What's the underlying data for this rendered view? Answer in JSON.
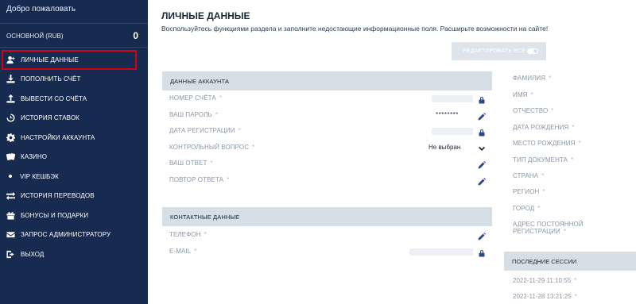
{
  "sidebar": {
    "welcome": "Добро пожаловать",
    "balance_label": "ОСНОВНОЙ (RUB)",
    "balance_value": "0",
    "items": [
      {
        "label": "ЛИЧНЫЕ ДАННЫЕ",
        "icon": "user-add-icon",
        "active": true
      },
      {
        "label": "ПОПОЛНИТЬ СЧЁТ",
        "icon": "download-icon"
      },
      {
        "label": "ВЫВЕСТИ СО СЧЁТА",
        "icon": "upload-icon"
      },
      {
        "label": "ИСТОРИЯ СТАВОК",
        "icon": "history-icon"
      },
      {
        "label": "НАСТРОЙКИ АККАУНТА",
        "icon": "gear-icon"
      },
      {
        "label": "КАЗИНО",
        "icon": "cards-icon"
      },
      {
        "label": "VIP КЕШБЭК",
        "icon": "dot-icon"
      },
      {
        "label": "ИСТОРИЯ ПЕРЕВОДОВ",
        "icon": "transfer-icon"
      },
      {
        "label": "БОНУСЫ И ПОДАРКИ",
        "icon": "gift-icon"
      },
      {
        "label": "ЗАПРОС АДМИНИСТРАТОРУ",
        "icon": "mail-icon"
      },
      {
        "label": "ВЫХОД",
        "icon": "logout-icon"
      }
    ]
  },
  "main": {
    "title": "ЛИЧНЫЕ ДАННЫЕ",
    "subtitle": "Воспользуйтесь функциями раздела и заполните недостающие информационные поля. Расширьте возможности на сайте!",
    "edit_all_label": "РЕДАКТИРОВАТЬ ВСЕ",
    "account_section": {
      "title": "ДАННЫЕ АККАУНТА",
      "fields": [
        {
          "label": "НОМЕР СЧЁТА",
          "value": "",
          "icon": "lock-icon"
        },
        {
          "label": "ВАШ ПАРОЛЬ",
          "value": "********",
          "icon": "pencil-icon"
        },
        {
          "label": "ДАТА РЕГИСТРАЦИИ",
          "value": "",
          "icon": "lock-icon"
        },
        {
          "label": "КОНТРОЛЬНЫЙ ВОПРОС",
          "value": "Не выбран",
          "icon": "chevron-down-icon"
        },
        {
          "label": "ВАШ ОТВЕТ",
          "value": "",
          "icon": "pencil-icon"
        },
        {
          "label": "ПОВТОР ОТВЕТА",
          "value": "",
          "icon": "pencil-icon"
        }
      ]
    },
    "contact_section": {
      "title": "КОНТАКТНЫЕ ДАННЫЕ",
      "fields": [
        {
          "label": "ТЕЛЕФОН",
          "value": "",
          "icon": "pencil-icon"
        },
        {
          "label": "E-MAIL",
          "value": "",
          "icon": "lock-icon"
        }
      ]
    },
    "personal_fields": [
      "ФАМИЛИЯ",
      "ИМЯ",
      "ОТЧЕСТВО",
      "ДАТА РОЖДЕНИЯ",
      "МЕСТО РОЖДЕНИЯ",
      "ТИП ДОКУМЕНТА",
      "СТРАНА",
      "РЕГИОН",
      "ГОРОД",
      "АДРЕС ПОСТОЯННОЙ РЕГИСТРАЦИИ"
    ],
    "sessions": {
      "title": "ПОСЛЕДНИЕ СЕССИИ",
      "items": [
        "2022-11-29 11:10:55",
        "2022-11-28 13:21:25"
      ]
    },
    "required_mark": "*"
  },
  "colors": {
    "sidebar_bg": "#172a4f",
    "section_bg": "#d6dfe5",
    "icon_blue": "#2b4a8a",
    "active_outline": "#d0021b"
  }
}
